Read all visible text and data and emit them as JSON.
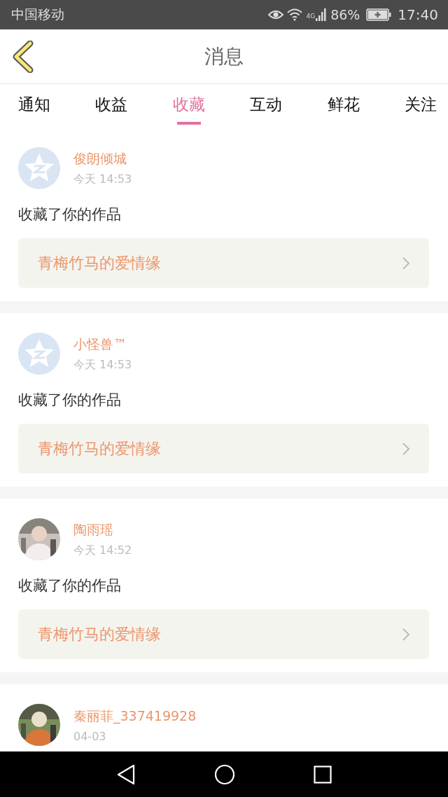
{
  "status_bar": {
    "carrier": "中国移动",
    "network": "4G",
    "battery": "86%",
    "time": "17:40"
  },
  "header": {
    "title": "消息"
  },
  "tabs": [
    {
      "label": "通知",
      "selected": false
    },
    {
      "label": "收益",
      "selected": false
    },
    {
      "label": "收藏",
      "selected": true
    },
    {
      "label": "互动",
      "selected": false
    },
    {
      "label": "鲜花",
      "selected": false
    },
    {
      "label": "关注",
      "selected": false
    }
  ],
  "messages": [
    {
      "avatar": {
        "kind": "default"
      },
      "user": "俊朗倾城",
      "time": "今天 14:53",
      "text": "收藏了你的作品",
      "work": "青梅竹马的爱情缘"
    },
    {
      "avatar": {
        "kind": "default"
      },
      "user": "小怪兽™",
      "time": "今天 14:53",
      "text": "收藏了你的作品",
      "work": "青梅竹马的爱情缘"
    },
    {
      "user": "陶雨瑶",
      "time": "今天 14:52",
      "text": "收藏了你的作品",
      "work": "青梅竹马的爱情缘"
    },
    {
      "user": "秦丽菲_337419928",
      "time": "04-03"
    }
  ]
}
